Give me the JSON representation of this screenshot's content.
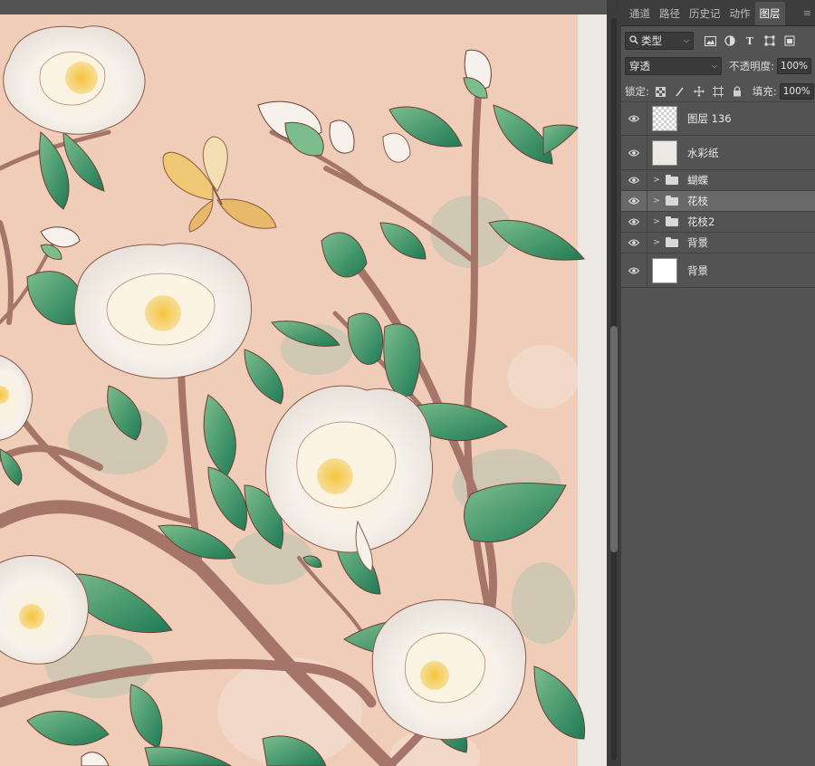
{
  "panel": {
    "tabs": [
      {
        "label": "通道",
        "active": false
      },
      {
        "label": "路径",
        "active": false
      },
      {
        "label": "历史记",
        "active": false
      },
      {
        "label": "动作",
        "active": false
      },
      {
        "label": "图层",
        "active": true
      }
    ],
    "filter": {
      "kind_label": "类型",
      "icons": [
        "image-filter-icon",
        "adjustment-filter-icon",
        "type-filter-icon",
        "shape-filter-icon",
        "smart-object-filter-icon"
      ]
    },
    "blend": {
      "mode": "穿透",
      "opacity_label": "不透明度:",
      "opacity_value": "100%"
    },
    "lock": {
      "label": "锁定:",
      "fill_label": "填充:",
      "fill_value": "100%"
    },
    "layers": [
      {
        "name": "图层 136",
        "type": "layer",
        "thumb": "transparent",
        "visible": true,
        "selected": false
      },
      {
        "name": "水彩纸",
        "type": "layer",
        "thumb": "paper",
        "visible": true,
        "selected": false
      },
      {
        "name": "蝴蝶",
        "type": "group",
        "visible": true,
        "selected": false
      },
      {
        "name": "花枝",
        "type": "group",
        "visible": true,
        "selected": true
      },
      {
        "name": "花枝2",
        "type": "group",
        "visible": true,
        "selected": false
      },
      {
        "name": "背景",
        "type": "group",
        "visible": true,
        "selected": false
      },
      {
        "name": "背景",
        "type": "layer",
        "thumb": "white",
        "visible": true,
        "selected": false
      }
    ]
  },
  "colors": {
    "canvas_bg": "#f0cdb9",
    "paper_edge": "#ece9e4",
    "leaf": "#2f8a5e",
    "leaf_light": "#6fae82",
    "branch": "#a9786a",
    "petal": "#f4f0ea",
    "stamen": "#e9b84a",
    "butterfly": "#e8c37a"
  }
}
